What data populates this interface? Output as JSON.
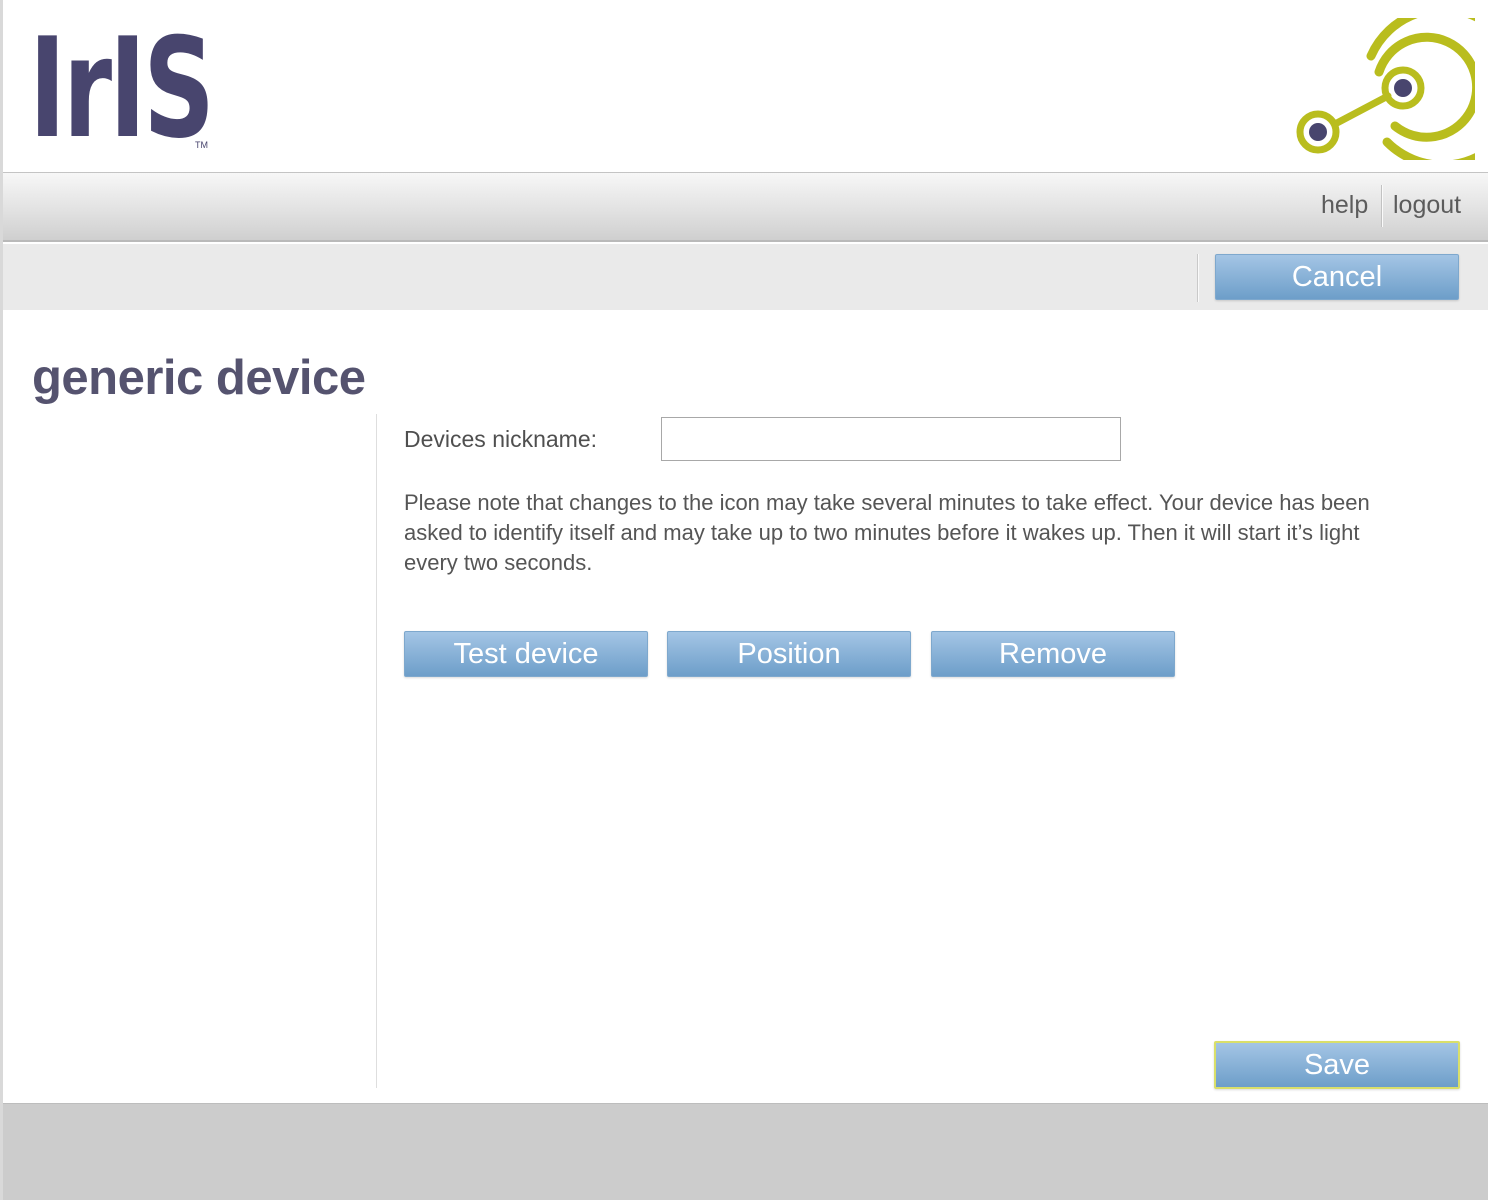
{
  "brand": {
    "logo_text": "IrIS",
    "trademark": "TM",
    "colors": {
      "logo": "#48456e",
      "icon": "#b9bd1e",
      "button": "#7ea9d1"
    }
  },
  "nav": {
    "help_label": "help",
    "logout_label": "logout"
  },
  "actions": {
    "cancel_label": "Cancel"
  },
  "page": {
    "title": "generic device"
  },
  "form": {
    "nickname_label": "Devices nickname:",
    "nickname_value": "",
    "note": "Please note that changes to the icon may take several minutes to take effect. Your device has been asked to identify itself and may take up to two minutes before it wakes up. Then it will start it’s light every two seconds."
  },
  "buttons": {
    "test_device": "Test device",
    "position": "Position",
    "remove": "Remove",
    "save": "Save"
  }
}
